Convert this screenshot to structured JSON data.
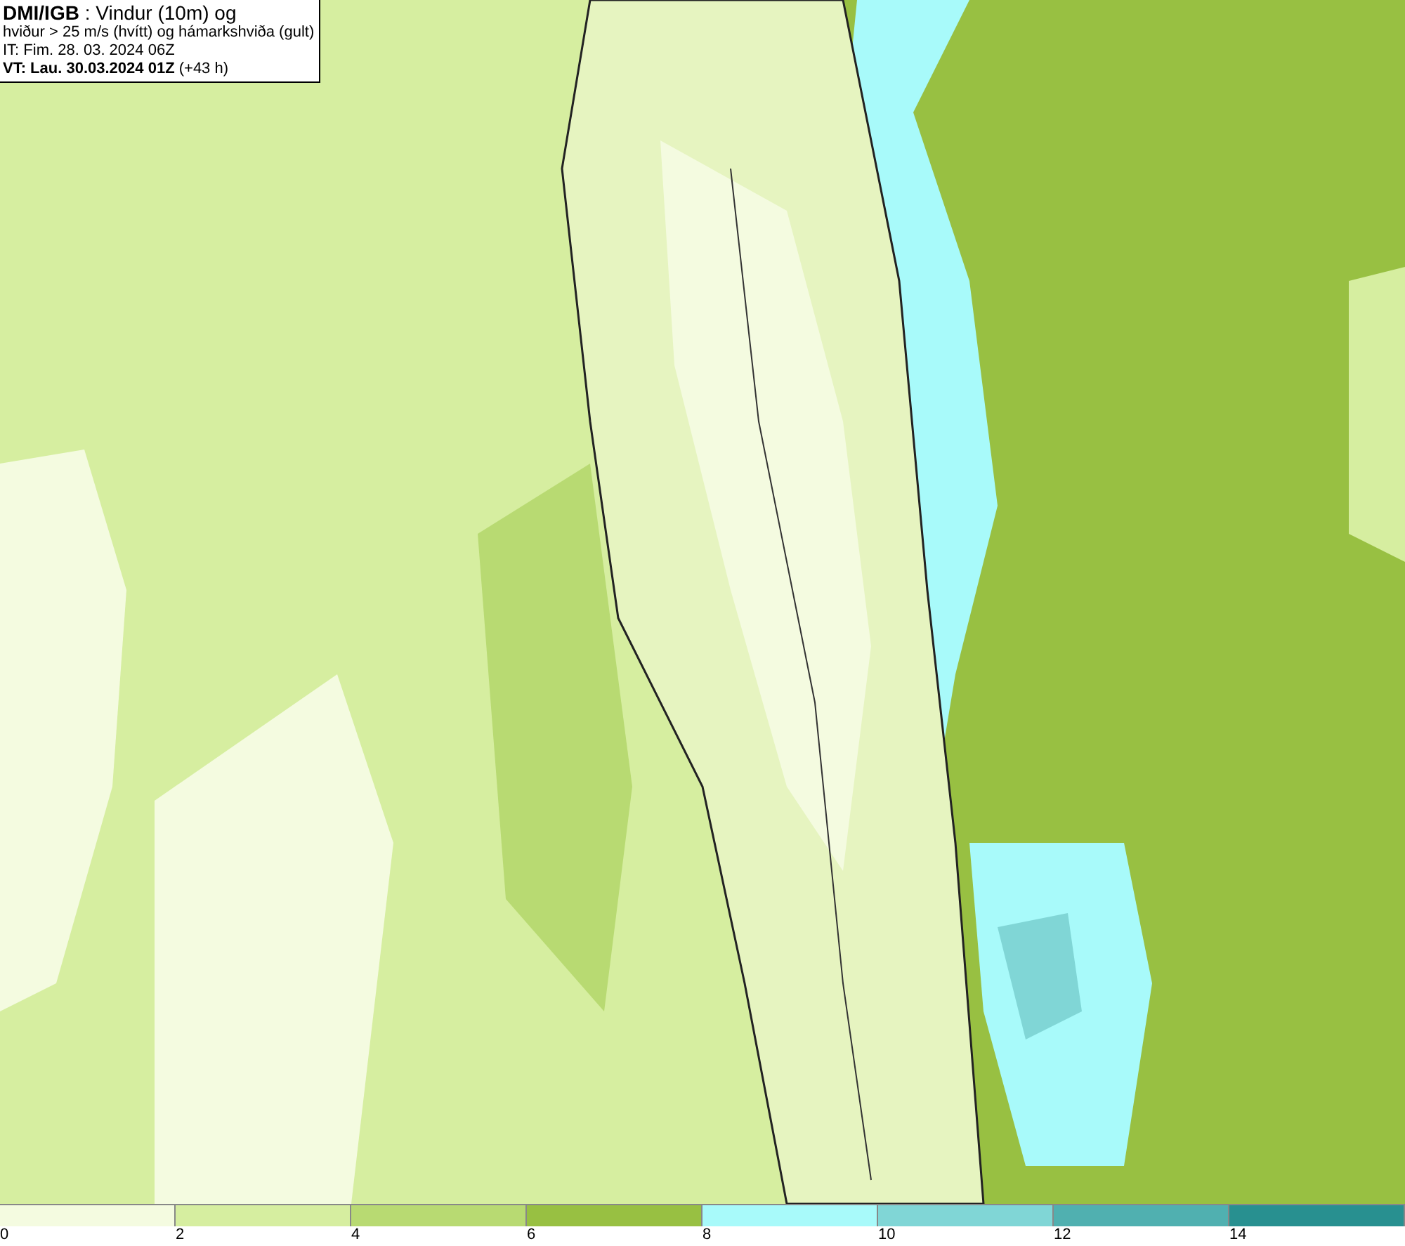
{
  "title_box": {
    "lines": [
      "**DMI/IGB** : Vindur (10m) og",
      "hviður > 25 m/s (hvítt) og hámarkshviða (gult)",
      "IT: Fim. 28. 03. 2024 06Z",
      "**VT: Lau. 30.03.2024 01Z** (+43 h)"
    ]
  },
  "legend": [
    {
      "label": "0",
      "color": "#f4fbe0"
    },
    {
      "label": "2",
      "color": "#d6eea0"
    },
    {
      "label": "4",
      "color": "#b8da72"
    },
    {
      "label": "6",
      "color": "#98c042"
    },
    {
      "label": "8",
      "color": "#a8fafa"
    },
    {
      "label": "10",
      "color": "#80d6d6"
    },
    {
      "label": "12",
      "color": "#50b0b0"
    },
    {
      "label": "14",
      "color": "#289090"
    }
  ]
}
